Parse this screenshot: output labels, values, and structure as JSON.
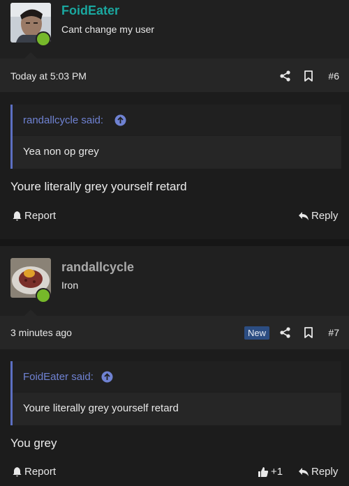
{
  "posts": [
    {
      "username": "FoidEater",
      "username_color": "#1aa79f",
      "user_title": "Cant change my user",
      "timestamp": "Today at 5:03 PM",
      "badge": "",
      "post_number": "#6",
      "quote": {
        "author": "randallcycle said:",
        "text": "Yea non op grey"
      },
      "message": "Youre literally grey yourself retard",
      "report_label": "Report",
      "reply_label": "Reply",
      "reaction_count": ""
    },
    {
      "username": "randallcycle",
      "username_color": "#a9a9a9",
      "user_title": "Iron",
      "timestamp": "3 minutes ago",
      "badge": "New",
      "post_number": "#7",
      "quote": {
        "author": "FoidEater said:",
        "text": "Youre literally grey yourself retard"
      },
      "message": "You grey",
      "report_label": "Report",
      "reply_label": "Reply",
      "reaction_count": "+1"
    }
  ],
  "colors": {
    "online": "#76b82a",
    "quote_accent": "#5c6fc2",
    "badge_bg": "#2c4d82"
  },
  "icons": [
    "share-icon",
    "bookmark-icon",
    "flag-icon",
    "reply-icon",
    "thumbs-up-icon",
    "arrow-up-circle-icon"
  ]
}
